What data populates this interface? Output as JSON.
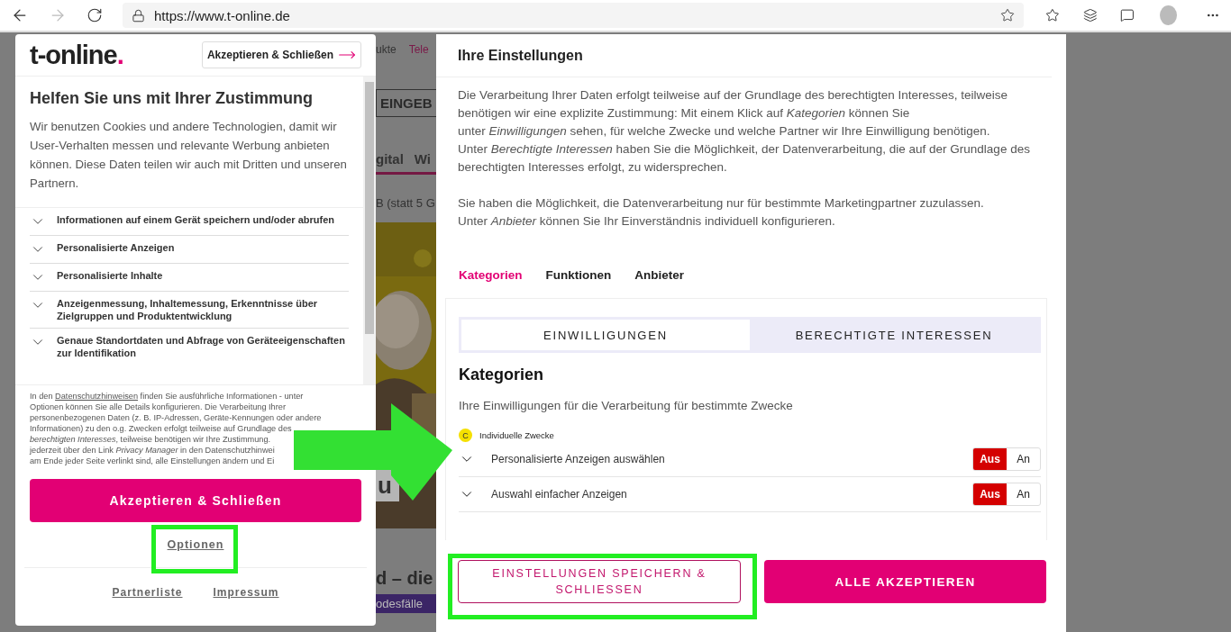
{
  "browser": {
    "url": "https://www.t-online.de"
  },
  "background_page": {
    "nav_fragments": [
      "ukte",
      "Tele"
    ],
    "button_fragment": "EINGEB",
    "tab_fragments": [
      "gital",
      "Wi"
    ],
    "offer_fragment": "B (statt 5 G",
    "photo_label": "u",
    "headline_fragment": "d – die",
    "caption_fragment": "odesfälle"
  },
  "consent_dialog": {
    "logo_text": "t-online",
    "logo_dot": ".",
    "header_button": "Akzeptieren & Schließen",
    "title": "Helfen Sie uns mit Ihrer Zustimmung",
    "intro": "Wir benutzen Cookies und andere Technologien, damit wir User-Verhalten messen und relevante Werbung anbieten können. Diese Daten teilen wir auch mit Dritten und unseren Partnern.",
    "purposes": [
      {
        "label": "Informationen auf einem Gerät speichern und/oder abrufen",
        "expanded": false
      },
      {
        "label": "Personalisierte Anzeigen",
        "expanded": false
      },
      {
        "label": "Personalisierte Inhalte",
        "expanded": false
      },
      {
        "label": "Anzeigenmessung, Inhaltemessung, Erkenntnisse über Zielgruppen und Produktentwicklung",
        "expanded": false
      },
      {
        "label": "Genaue Standortdaten und Abfrage von Geräteeigenschaften zur Identifikation",
        "expanded": false
      }
    ],
    "legal_lead": "In den ",
    "legal_link": "Datenschutzhinweisen",
    "legal_lines": [
      " finden Sie ausführliche Informationen - unter",
      "Optionen können Sie alle Details konfigurieren. Die Verarbeitung Ihrer",
      "personenbezogenen Daten (z. B. IP-Adressen, Geräte-Kennungen oder andere",
      "Informationen) zu den o.g. Zwecken erfolgt teilweise auf Grundlage des",
      "*berechtigten Interesses*, teilweise benötigen wir Ihre Zustimmung.",
      "jederzeit über den Link *Privacy Manager* in den Datenschutzhinwei",
      "am Ende jeder Seite verlinkt sind, alle Einstellungen ändern und Ei"
    ],
    "accept_button": "Akzeptieren & Schließen",
    "options_link": "Optionen",
    "footer_links": [
      "Partnerliste",
      "Impressum"
    ]
  },
  "settings_dialog": {
    "title": "Ihre Einstellungen",
    "paragraphs": [
      [
        "Die Verarbeitung Ihrer Daten erfolgt teilweise auf der Grundlage des berechtigten Interesses, teilweise",
        "benötigen wir eine explizite Zustimmung: Mit einem Klick auf *Kategorien* können Sie",
        "unter *Einwilligungen* sehen, für welche Zwecke und welche Partner wir Ihre Einwilligung benötigen.",
        "Unter *Berechtigte Interessen* haben Sie die Möglichkeit, der Datenverarbeitung, die auf der Grundlage des",
        "berechtigten Interesses erfolgt, zu widersprechen."
      ],
      [
        "Sie haben die Möglichkeit, die Datenverarbeitung nur für bestimmte Marketingpartner zuzulassen.",
        "Unter *Anbieter* können Sie Ihr Einverständnis individuell konfigurieren."
      ]
    ],
    "tabs": [
      {
        "label": "Kategorien",
        "selected": true
      },
      {
        "label": "Funktionen",
        "selected": false
      },
      {
        "label": "Anbieter",
        "selected": false
      }
    ],
    "segments": [
      {
        "label": "EINWILLIGUNGEN",
        "selected": true
      },
      {
        "label": "BERECHTIGTE INTERESSEN",
        "selected": false
      }
    ],
    "heading": "Kategorien",
    "subheading": "Ihre Einwilligungen für die Verarbeitung für bestimmte Zwecke",
    "group": {
      "badge": "C",
      "label": "Individuelle Zwecke"
    },
    "purposes": [
      {
        "label": "Personalisierte Anzeigen auswählen",
        "off_label": "Aus",
        "on_label": "An",
        "on": false
      },
      {
        "label": "Auswahl einfacher Anzeigen",
        "off_label": "Aus",
        "on_label": "An",
        "on": false
      }
    ],
    "save_button": "EINSTELLUNGEN SPEICHERN & SCHLIESSEN",
    "accept_all_button": "ALLE AKZEPTIEREN"
  }
}
